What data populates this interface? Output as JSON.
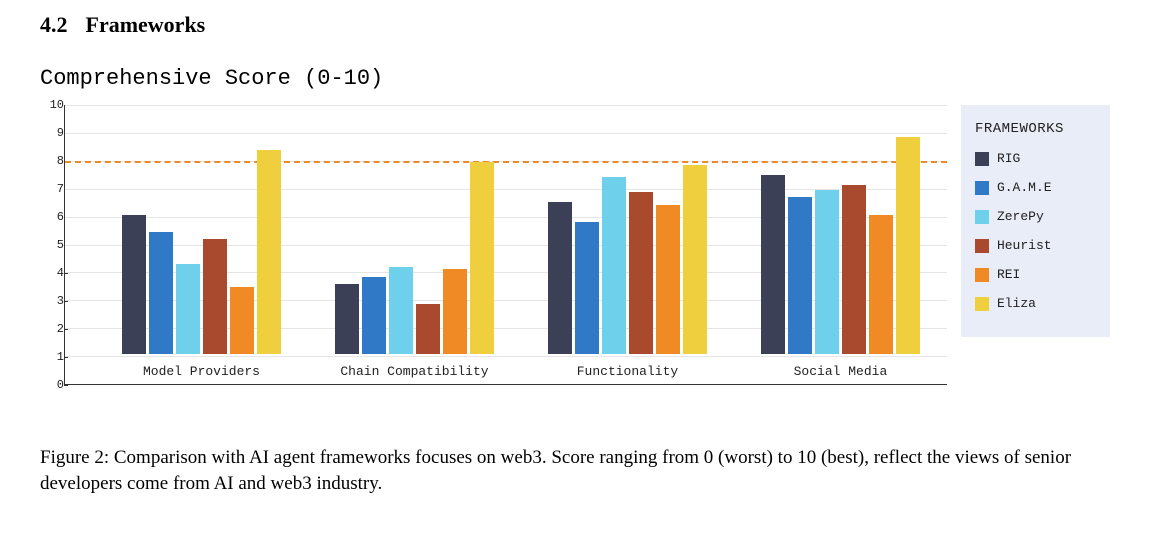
{
  "heading": {
    "number": "4.2",
    "text": "Frameworks"
  },
  "chart_data": {
    "type": "bar",
    "title": "Comprehensive Score (0-10)",
    "ylabel": "",
    "xlabel": "",
    "ylim": [
      0,
      10
    ],
    "yticks": [
      0,
      1,
      2,
      3,
      4,
      5,
      6,
      7,
      8,
      9,
      10
    ],
    "reference_line": 8,
    "categories": [
      "Model Providers",
      "Chain Compatibility",
      "Functionality",
      "Social Media"
    ],
    "series": [
      {
        "name": "RIG",
        "color": "#3b4057",
        "values": [
          5.6,
          2.8,
          6.1,
          7.2
        ]
      },
      {
        "name": "G.A.M.E",
        "color": "#2f79c6",
        "values": [
          4.9,
          3.1,
          5.3,
          6.3
        ]
      },
      {
        "name": "ZerePy",
        "color": "#6fd0eb",
        "values": [
          3.6,
          3.5,
          7.1,
          6.6
        ]
      },
      {
        "name": "Heurist",
        "color": "#a9492e",
        "values": [
          4.6,
          2.0,
          6.5,
          6.8
        ]
      },
      {
        "name": "REI",
        "color": "#f08a24",
        "values": [
          2.7,
          3.4,
          6.0,
          5.6
        ]
      },
      {
        "name": "Eliza",
        "color": "#f0cf3e",
        "values": [
          8.2,
          7.7,
          7.6,
          8.7
        ]
      }
    ],
    "legend_title": "FRAMEWORKS"
  },
  "caption": "Figure 2: Comparison with AI agent frameworks focuses on web3. Score ranging from 0 (worst) to 10 (best), reflect the views of senior developers come from AI and web3 industry."
}
